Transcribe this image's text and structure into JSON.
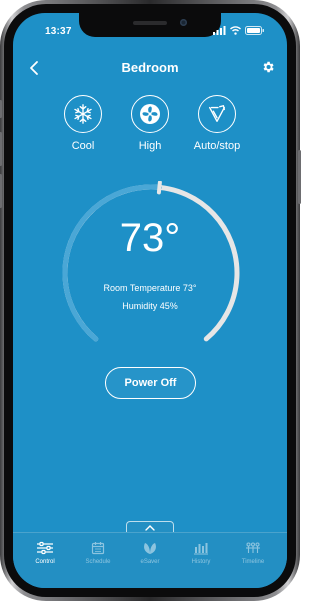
{
  "status_bar": {
    "time": "13:37"
  },
  "header": {
    "title": "Bedroom"
  },
  "modes": [
    {
      "label": "Cool",
      "icon": "snowflake-icon"
    },
    {
      "label": "High",
      "icon": "fan-icon"
    },
    {
      "label": "Auto/stop",
      "icon": "swing-icon"
    }
  ],
  "thermostat": {
    "setpoint": "73°",
    "room_temperature": "Room Temperature 73°",
    "humidity": "Humidity 45%",
    "dial_level": 0.52
  },
  "power_button": {
    "label": "Power Off"
  },
  "tabs": [
    {
      "label": "Control",
      "icon": "sliders-icon",
      "active": true
    },
    {
      "label": "Schedule",
      "icon": "calendar-icon",
      "active": false
    },
    {
      "label": "eSaver",
      "icon": "leaf-icon",
      "active": false
    },
    {
      "label": "History",
      "icon": "bar-chart-icon",
      "active": false
    },
    {
      "label": "Timeline",
      "icon": "timeline-icon",
      "active": false
    }
  ],
  "colors": {
    "screen_bg": "#1e90c7",
    "tab_bg": "#238fc3",
    "text": "#ffffff",
    "arc_track": "#e6e6e6"
  }
}
